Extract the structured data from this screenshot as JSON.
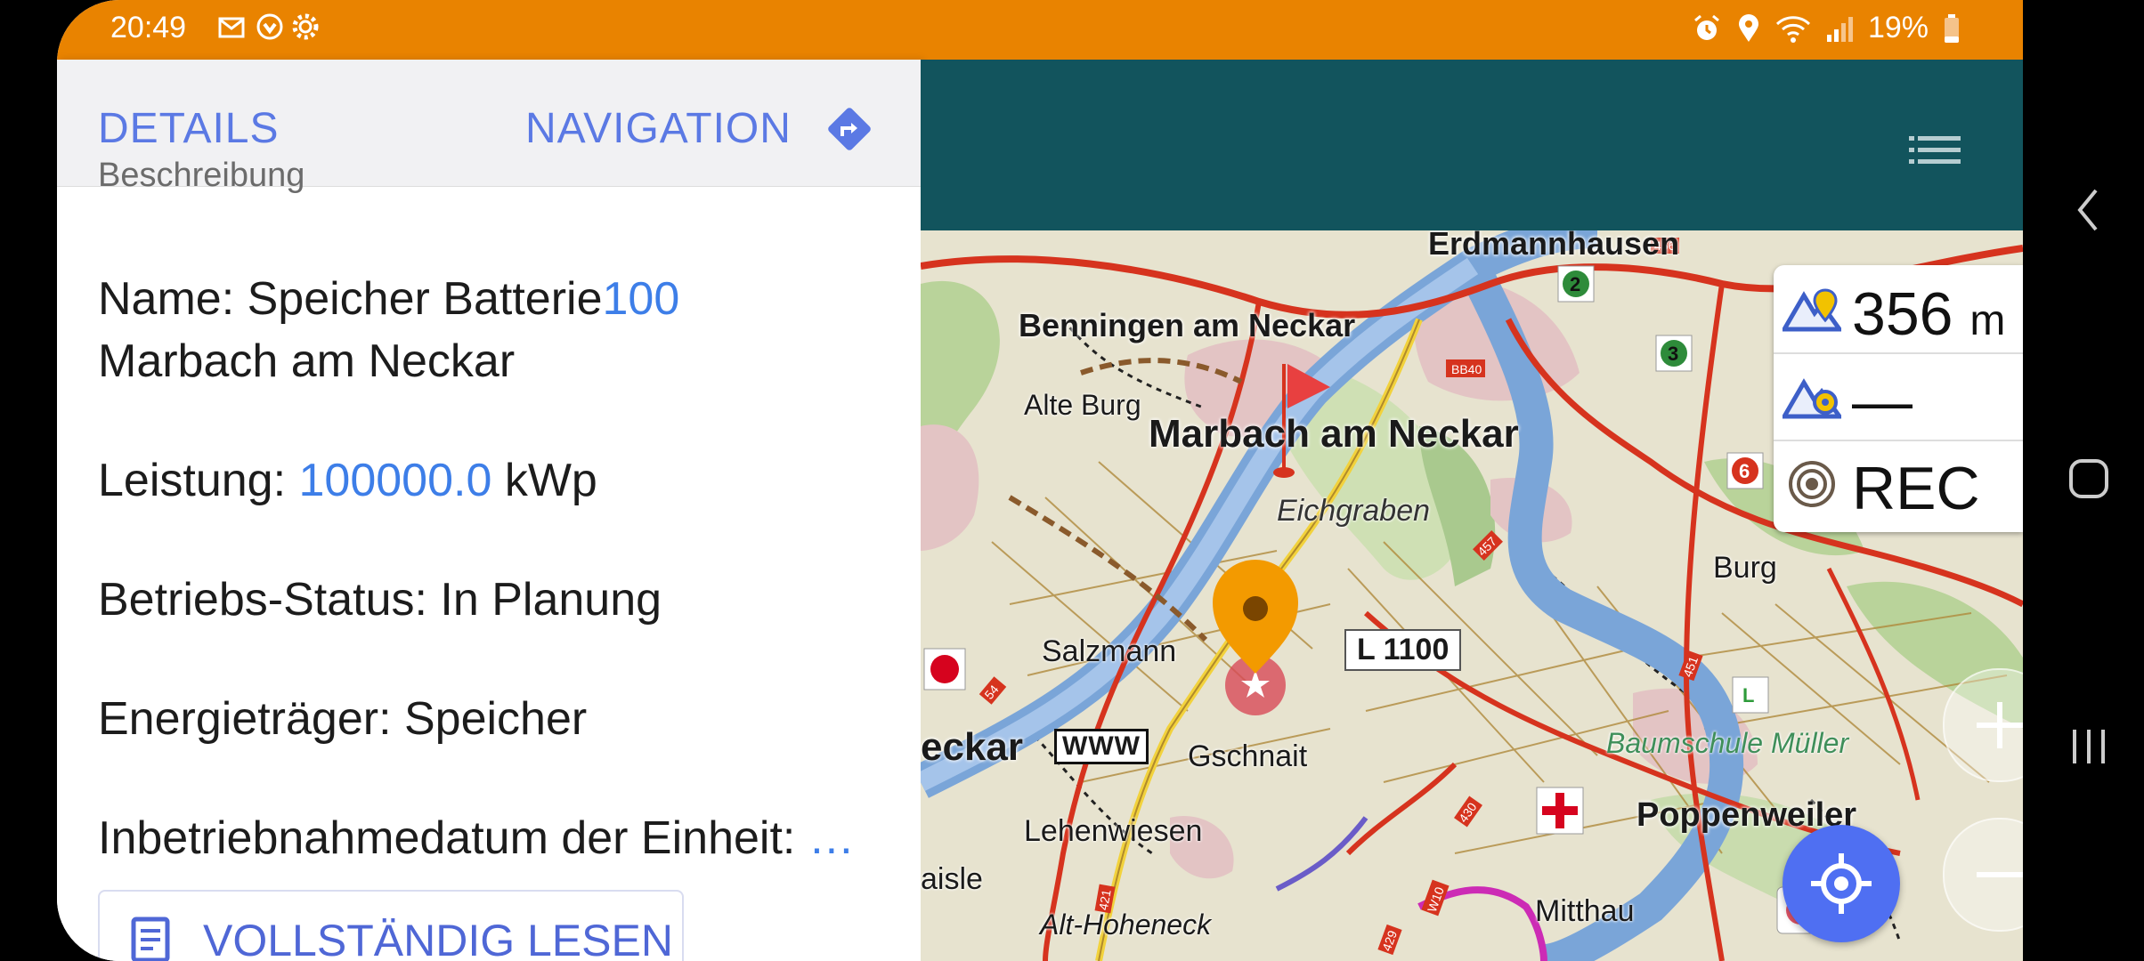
{
  "status_bar": {
    "time": "20:49",
    "battery": "19%",
    "icons": [
      "mail-icon",
      "vpn-icon",
      "settings-icon",
      "alarm-icon",
      "location-icon",
      "wifi-icon",
      "signal-icon",
      "battery-icon"
    ]
  },
  "panel": {
    "tab_details": "DETAILS",
    "navigation_button": "NAVIGATION",
    "section_label": "Beschreibung",
    "name_prefix": "Name: Speicher Batterie",
    "name_link": "100",
    "name_line2": "Marbach am Neckar",
    "power_label": "Leistung: ",
    "power_value": "100000.0",
    "power_unit": " kWp",
    "status_line": "Betriebs-Status: In Planung",
    "energy_line": "Energieträger: Speicher",
    "date_label": "Inbetriebnahmedatum der Einheit: ",
    "date_ellipsis": "…",
    "read_full_button": "VOLLSTÄNDIG LESEN"
  },
  "map": {
    "labels": {
      "erdmannhausen": "Erdmannhausen",
      "benningen": "Benningen am Neckar",
      "alte_burg": "Alte Burg",
      "marbach": "Marbach am Neckar",
      "eichgraben": "Eichgraben",
      "burg": "Burg",
      "salzmann": "Salzmann",
      "road_l1100": "L 1100",
      "neckar": "eckar",
      "www": "WWW",
      "gschnait": "Gschnait",
      "baumschule": "Baumschule Müller",
      "poppenweiler": "Poppenweiler",
      "lehenwiesen": "Lehenwiesen",
      "aisle": "aisle",
      "alt_hoheneck": "Alt-Hoheneck",
      "mitthau": "Mitthau",
      "bb40": "BB40",
      "r456": "456",
      "r457": "457",
      "r430": "430",
      "r429": "429",
      "r421": "421",
      "r54": "54",
      "w10": "W10",
      "r451": "451"
    },
    "markers": {
      "badge_2": "2",
      "badge_3": "3",
      "badge_6": "6",
      "badge_l": "L"
    },
    "widgets": {
      "altitude_value": "356",
      "altitude_unit": "m",
      "second_value": "—",
      "rec_label": "REC"
    },
    "accent_color": "#4f6ff2"
  }
}
